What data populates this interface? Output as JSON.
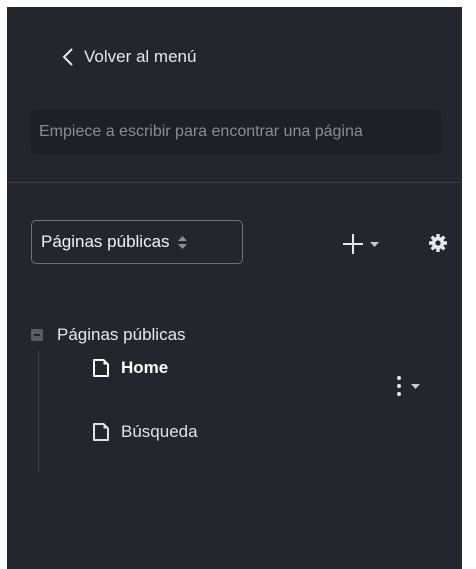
{
  "nav": {
    "back_label": "Volver al menú"
  },
  "search": {
    "placeholder": "Empiece a escribir para encontrar una página",
    "value": ""
  },
  "toolbar": {
    "site_select_value": "Páginas públicas",
    "icons": {
      "add": "plus-icon",
      "add_dropdown": "caret-down-icon",
      "settings": "gear-icon"
    }
  },
  "tree": {
    "root_label": "Páginas públicas",
    "items": [
      {
        "label": "Home",
        "selected": true,
        "icon": "page-icon"
      },
      {
        "label": "Búsqueda",
        "selected": false,
        "icon": "page-icon"
      }
    ]
  },
  "colors": {
    "panel_bg": "#25262d",
    "input_bg": "#1f2026",
    "text": "#e4e4e8"
  }
}
